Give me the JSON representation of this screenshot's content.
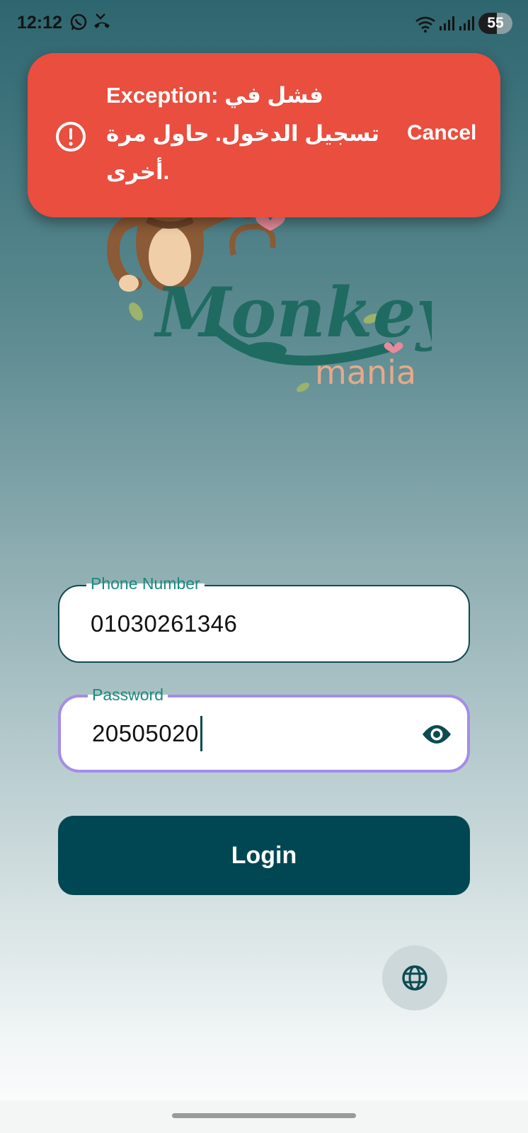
{
  "status_bar": {
    "time": "12:12",
    "battery": "55",
    "icons": [
      "whatsapp-icon",
      "missed-call-icon",
      "wifi-icon",
      "signal-icon",
      "signal-icon",
      "battery-icon"
    ]
  },
  "snackbar": {
    "lines": [
      "Exception: فشل في",
      "تسجيل الدخول. حاول مرة",
      "أخرى."
    ],
    "action": "Cancel",
    "icon": "error-circle-icon",
    "color": "#e94e3e"
  },
  "logo": {
    "title": "Monkey",
    "subtitle": "mania"
  },
  "form": {
    "phone": {
      "label": "Phone Number",
      "value": "01030261346"
    },
    "password": {
      "label": "Password",
      "value": "20505020",
      "toggle_icon": "eye-icon"
    },
    "login_label": "Login",
    "language_icon": "globe-icon"
  },
  "colors": {
    "accent": "#014753",
    "label": "#1a8a7e",
    "focus_border": "#a58ce8",
    "error": "#e94e3e"
  }
}
